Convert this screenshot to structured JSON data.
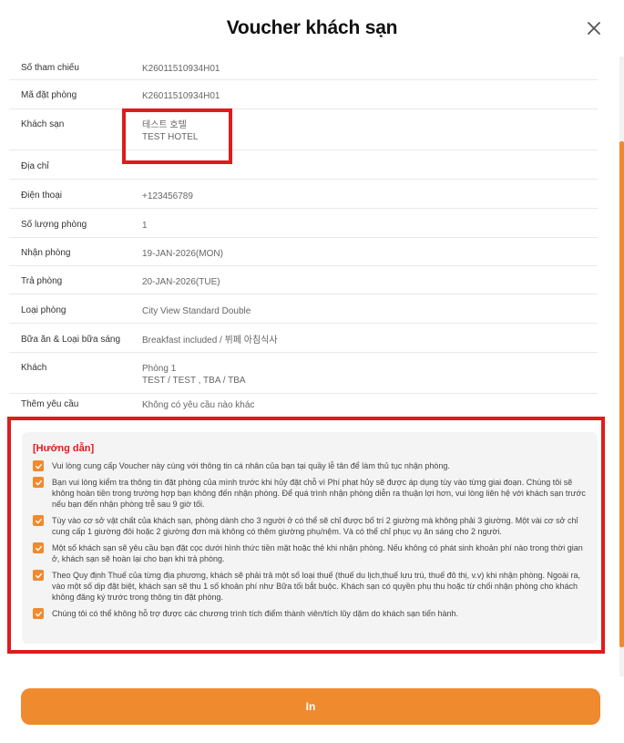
{
  "header": {
    "title": "Voucher khách sạn"
  },
  "booking": [
    {
      "label": "Số tham chiếu",
      "lines": [
        "K26011510934H01"
      ]
    },
    {
      "label": "Mã đặt phòng",
      "lines": [
        "K26011510934H01"
      ]
    },
    {
      "label": "Khách sạn",
      "lines": [
        "테스트 호텔",
        "TEST HOTEL"
      ]
    },
    {
      "label": "Địa chỉ",
      "lines": []
    },
    {
      "label": "Điện thoại",
      "lines": [
        "+123456789"
      ]
    },
    {
      "label": "Số lượng phòng",
      "lines": [
        "1"
      ]
    },
    {
      "label": "Nhận phòng",
      "lines": [
        "19-JAN-2026(MON)"
      ]
    },
    {
      "label": "Trả phòng",
      "lines": [
        "20-JAN-2026(TUE)"
      ]
    },
    {
      "label": "Loại phòng",
      "lines": [
        "City View Standard Double"
      ]
    },
    {
      "label": "Bữa ăn & Loại bữa sáng",
      "lines": [
        "Breakfast included / 뷔페 아침식사"
      ]
    },
    {
      "label": "Khách",
      "lines": [
        "Phòng 1",
        "TEST / TEST , TBA / TBA"
      ]
    },
    {
      "label": "Thêm yêu cầu",
      "lines": [
        "Không có yêu cầu nào khác"
      ]
    }
  ],
  "guide": {
    "title": "[Hướng dẫn]",
    "items": [
      "Vui lòng cung cấp Voucher này cùng với thông tin cá nhân của bạn tại quầy lễ tân để làm thủ tục nhận phòng.",
      "Bạn vui lòng kiểm tra thông tin đặt phòng của mình trước khi hủy đặt chỗ vì Phí phạt hủy sẽ được áp dụng tùy vào từng giai đoạn. Chúng tôi sẽ không hoàn tiền trong trường hợp bạn không đến nhận phòng. Để quá trình nhận phòng diễn ra thuận lợi hơn, vui lòng liên hệ với khách sạn trước nếu bạn đến nhận phòng trễ sau 9 giờ tối.",
      "Tùy vào cơ sở vật chất của khách sạn, phòng dành cho 3 người ở có thể sẽ chỉ được bố trí 2 giường mà không phải 3 giường. Một vài cơ sở chỉ cung cấp 1 giường đôi hoặc 2 giường đơn mà không có thêm giường phụ/nệm. Và có thể chỉ phục vụ ăn sáng cho 2 người.",
      "Một số khách sạn sẽ yêu cầu bạn đặt cọc dưới hình thức tiền mặt hoặc thẻ khi nhận phòng. Nếu không có phát sinh khoản phí nào trong thời gian ở, khách sạn sẽ hoàn lại cho bạn khi trả phòng.",
      "Theo Quy định Thuế của từng địa phương, khách sẽ phải trả một số loại thuế (thuế du lịch,thuế lưu trú, thuế đô thị, v.v) khi nhận phòng. Ngoài ra, vào một số dịp đặt biệt, khách sạn sẽ thu 1 số khoản phí như Bữa tối bắt buộc. Khách sạn có quyền phụ thu hoặc từ chối nhận phòng cho khách không đăng ký trước trong thông tin đặt phòng.",
      "Chúng tôi có thể không hỗ trợ được các chương trình tích điểm thành viên/tích lũy dặm do khách sạn tiến hành."
    ]
  },
  "footer": {
    "print_label": "In"
  },
  "colors": {
    "accent": "#f08a2e",
    "highlight": "#e01b1b"
  }
}
